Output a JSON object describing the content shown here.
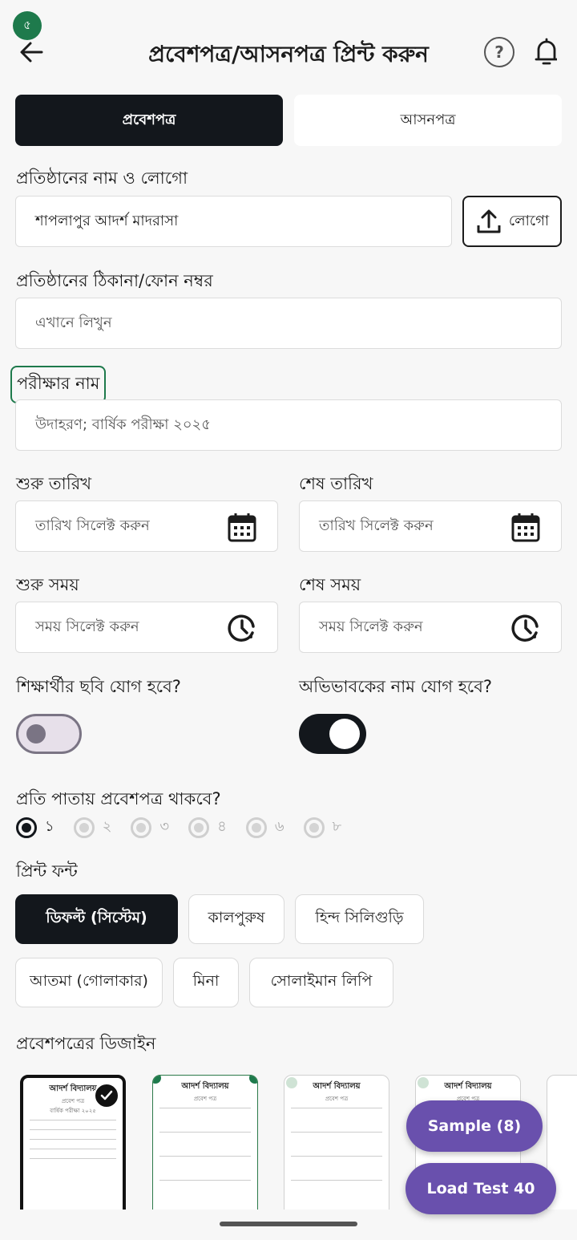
{
  "status": {
    "badge": "৫"
  },
  "header": {
    "title": "প্রবেশপত্র/আসনপত্র প্রিন্ট করুন",
    "help_label": "?"
  },
  "tabs": [
    {
      "label": "প্রবেশপত্র",
      "active": true
    },
    {
      "label": "আসনপত্র",
      "active": false
    }
  ],
  "institution": {
    "label": "প্রতিষ্ঠানের নাম ও লোগো",
    "name_value": "শাপলাপুর আদর্শ মাদরাসা",
    "logo_button": "লোগো"
  },
  "address": {
    "label": "প্রতিষ্ঠানের ঠিকানা/ফোন নম্বর",
    "placeholder": "এখানে লিখুন"
  },
  "exam": {
    "label": "পরীক্ষার নাম",
    "placeholder": "উদাহরণ; বার্ষিক পরীক্ষা ২০২৫"
  },
  "dates": {
    "start_label": "শুরু তারিখ",
    "end_label": "শেষ তারিখ",
    "placeholder": "তারিখ সিলেক্ট করুন"
  },
  "times": {
    "start_label": "শুরু সময়",
    "end_label": "শেষ সময়",
    "placeholder": "সময় সিলেক্ট করুন"
  },
  "toggles": {
    "photo_label": "শিক্ষার্থীর ছবি যোগ হবে?",
    "photo_on": false,
    "guardian_label": "অভিভাবকের নাম যোগ হবে?",
    "guardian_on": true
  },
  "per_page": {
    "label": "প্রতি পাতায় প্রবেশপত্র থাকবে?",
    "options": [
      "১",
      "২",
      "৩",
      "৪",
      "৬",
      "৮"
    ],
    "selected": "১"
  },
  "font": {
    "label": "প্রিন্ট ফন্ট",
    "options": [
      "ডিফল্ট (সিস্টেম)",
      "কালপুরুষ",
      "হিন্দ সিলিগুড়ি",
      "আতমা (গোলাকার)",
      "মিনা",
      "সোলাইমান লিপি"
    ],
    "selected": "ডিফল্ট (সিস্টেম)"
  },
  "design": {
    "label": "প্রবেশপত্রের ডিজাইন",
    "card_title": "আদর্শ বিদ্যালয়",
    "card_subtitle": "প্রবেশ পত্র",
    "card_exam": "বার্ষিক পরীক্ষা ২০২৫"
  },
  "fabs": {
    "sample": "Sample (8)",
    "load": "Load Test 40"
  },
  "colors": {
    "accent": "#6950ad",
    "dark": "#13171c",
    "green": "#1e7a4c"
  }
}
